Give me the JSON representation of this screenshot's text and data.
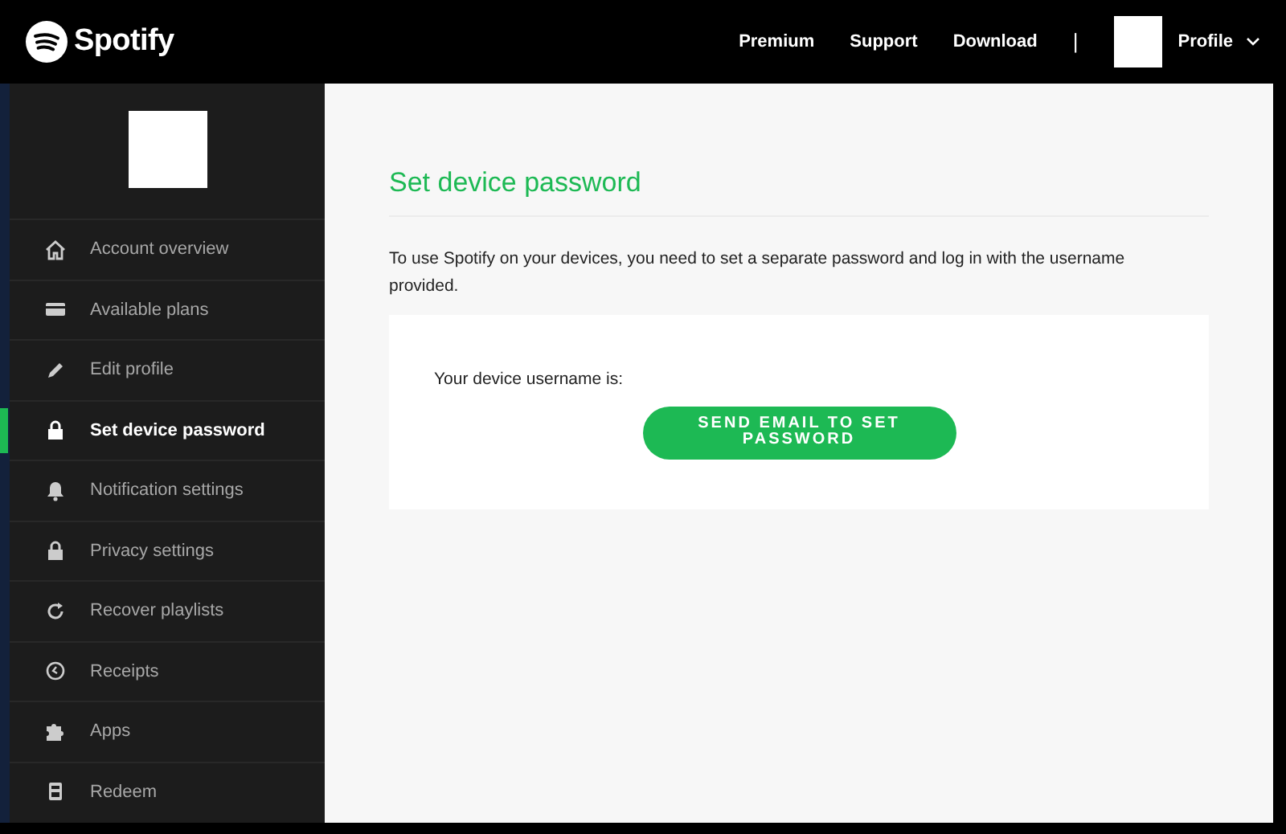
{
  "header": {
    "logo": "Spotify",
    "links": [
      "Premium",
      "Support",
      "Download"
    ],
    "divider": "|",
    "profile": "Profile"
  },
  "sidebar": {
    "items": [
      {
        "label": "Account overview",
        "selected": false
      },
      {
        "label": "Available plans",
        "selected": false
      },
      {
        "label": "Edit profile",
        "selected": false
      },
      {
        "label": "Set device password",
        "selected": true
      },
      {
        "label": "Notification settings",
        "selected": false
      },
      {
        "label": "Privacy settings",
        "selected": false
      },
      {
        "label": "Recover playlists",
        "selected": false
      },
      {
        "label": "Receipts",
        "selected": false
      },
      {
        "label": "Apps",
        "selected": false
      },
      {
        "label": "Redeem",
        "selected": false
      }
    ]
  },
  "main": {
    "title": "Set device password",
    "description": "To use Spotify on your devices, you need to set a separate password and log in with the username provided.",
    "username_label": "Your device username is:",
    "button": "SEND EMAIL TO SET PASSWORD"
  }
}
